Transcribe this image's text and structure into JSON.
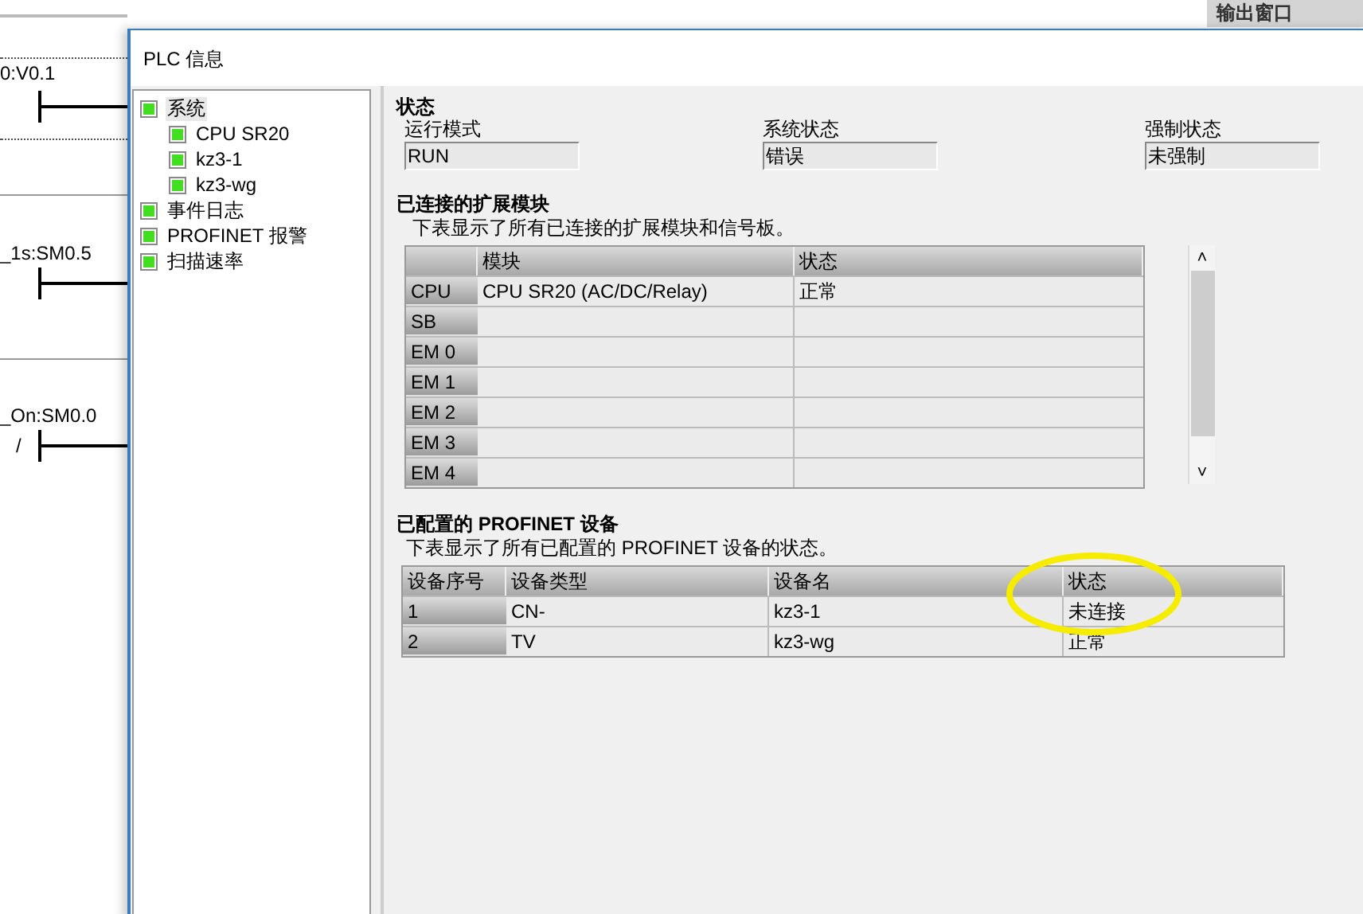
{
  "background_editor": {
    "labels": [
      "0:V0.1",
      "_1s:SM0.5",
      "_On:SM0.0"
    ],
    "negation": "/"
  },
  "output_window_tab": "输出窗口",
  "window": {
    "title": "PLC 信息"
  },
  "tree": [
    {
      "label": "系统",
      "selected": true,
      "children": [
        {
          "label": "CPU SR20",
          "selected": false
        },
        {
          "label": "kz3-1",
          "selected": false
        },
        {
          "label": "kz3-wg",
          "selected": false
        }
      ]
    },
    {
      "label": "事件日志",
      "selected": false
    },
    {
      "label": "PROFINET 报警",
      "selected": false
    },
    {
      "label": "扫描速率",
      "selected": false
    }
  ],
  "status": {
    "heading": "状态",
    "fields": [
      {
        "label": "运行模式",
        "value": "RUN"
      },
      {
        "label": "系统状态",
        "value": "错误"
      },
      {
        "label": "强制状态",
        "value": "未强制"
      }
    ]
  },
  "modules": {
    "heading": "已连接的扩展模块",
    "description": "下表显示了所有已连接的扩展模块和信号板。",
    "columns": [
      "模块",
      "状态"
    ],
    "rows": [
      {
        "slot": "CPU",
        "module": "CPU SR20 (AC/DC/Relay)",
        "state": "正常"
      },
      {
        "slot": "SB"
      },
      {
        "slot": "EM 0"
      },
      {
        "slot": "EM 1"
      },
      {
        "slot": "EM 2"
      },
      {
        "slot": "EM 3"
      },
      {
        "slot": "EM 4"
      }
    ],
    "scroll_up": "˄",
    "scroll_down": "˅"
  },
  "profinet": {
    "heading": "已配置的 PROFINET 设备",
    "description": "下表显示了所有已配置的 PROFINET 设备的状态。",
    "columns": [
      "设备序号",
      "设备类型",
      "设备名",
      "状态"
    ],
    "rows": [
      {
        "cells": [
          "1",
          "CN-",
          "kz3-1",
          "未连接"
        ]
      },
      {
        "cells": [
          "2",
          "TV",
          "kz3-wg",
          "正常"
        ]
      }
    ],
    "highlight": true
  }
}
